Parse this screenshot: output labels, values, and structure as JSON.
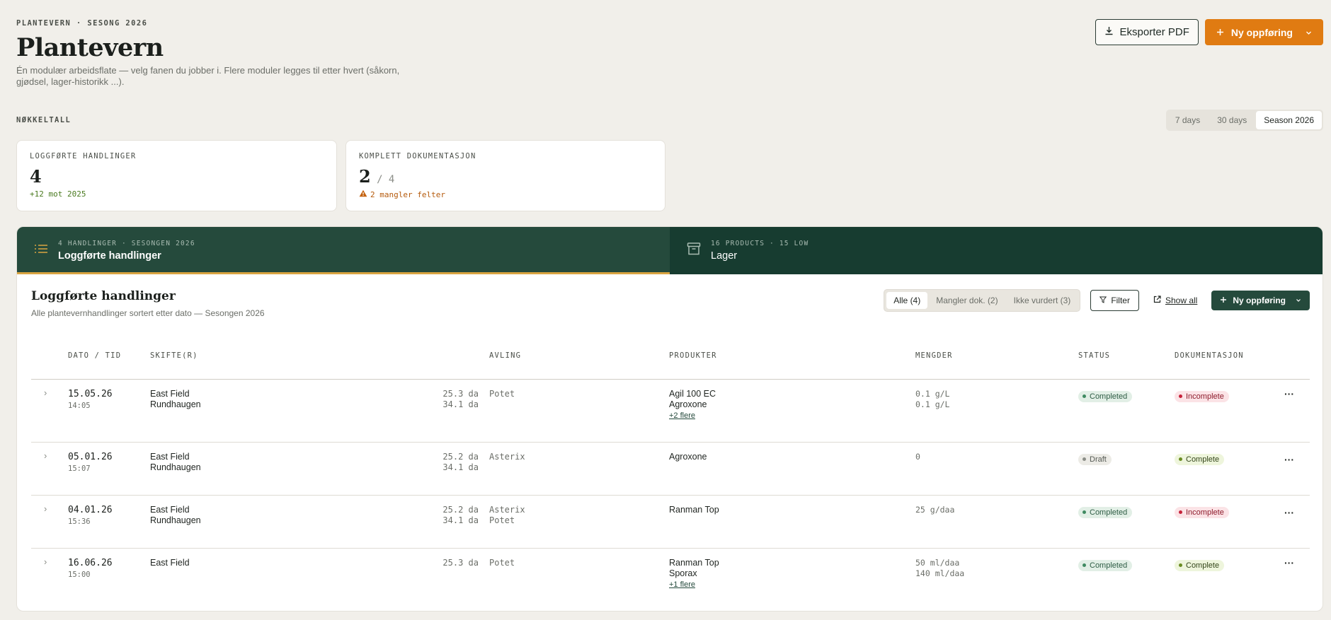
{
  "header": {
    "eyebrow": "PLANTEVERN · SESONG 2026",
    "title": "Plantevern",
    "subtitle": "Én modulær arbeidsflate — velg fanen du jobber i. Flere moduler legges til etter hvert (såkorn, gjødsel, lager-historikk ...).",
    "export_label": "Eksporter PDF",
    "new_entry_label": "Ny oppføring"
  },
  "kpi": {
    "section_label": "NØKKELTALL",
    "ranges": [
      "7 days",
      "30 days",
      "Season 2026"
    ],
    "active_range": "Season 2026",
    "cards": [
      {
        "title": "LOGGFØRTE HANDLINGER",
        "value": "4",
        "of": "",
        "note": "+12 mot 2025"
      },
      {
        "title": "KOMPLETT DOKUMENTASJON",
        "value": "2",
        "of": "/ 4",
        "note": "2 mangler felter"
      }
    ]
  },
  "tabs": [
    {
      "meta": "4 HANDLINGER · SESONGEN 2026",
      "name": "Loggførte handlinger",
      "icon": "list-icon",
      "active": true
    },
    {
      "meta": "16 PRODUCTS · 15 LOW",
      "name": "Lager",
      "icon": "archive-icon",
      "active": false
    }
  ],
  "section": {
    "title": "Loggførte handlinger",
    "subtitle": "Alle plantevernhandlinger sortert etter dato — Sesongen 2026",
    "segments": [
      "Alle (4)",
      "Mangler dok. (2)",
      "Ikke vurdert (3)"
    ],
    "filter_label": "Filter",
    "show_all_label": "Show all",
    "new_entry_label": "Ny oppføring"
  },
  "table": {
    "columns": {
      "date": "DATO / TID",
      "fields": "SKIFTE(R)",
      "crop": "AVLING",
      "products": "PRODUKTER",
      "amounts": "MENGDER",
      "status": "STATUS",
      "docs": "DOKUMENTASJON"
    },
    "rows": [
      {
        "date": "15.05.26",
        "time": "14:05",
        "fields": [
          "East Field",
          "Rundhaugen"
        ],
        "areas": [
          "25.3 da",
          "34.1 da"
        ],
        "crops": [
          "Potet"
        ],
        "products": [
          "Agil 100 EC",
          "Agroxone"
        ],
        "more": "+2 flere",
        "amounts": [
          "0.1 g/L",
          "0.1 g/L"
        ],
        "status": "Completed",
        "docs": "Incomplete"
      },
      {
        "date": "05.01.26",
        "time": "15:07",
        "fields": [
          "East Field",
          "Rundhaugen"
        ],
        "areas": [
          "25.2 da",
          "34.1 da"
        ],
        "crops": [
          "Asterix"
        ],
        "products": [
          "Agroxone"
        ],
        "more": "",
        "amounts": [
          "0"
        ],
        "status": "Draft",
        "docs": "Complete"
      },
      {
        "date": "04.01.26",
        "time": "15:36",
        "fields": [
          "East Field",
          "Rundhaugen"
        ],
        "areas": [
          "25.2 da",
          "34.1 da"
        ],
        "crops": [
          "Asterix",
          "Potet"
        ],
        "products": [
          "Ranman Top"
        ],
        "more": "",
        "amounts": [
          "25 g/daa"
        ],
        "status": "Completed",
        "docs": "Incomplete"
      },
      {
        "date": "16.06.26",
        "time": "15:00",
        "fields": [
          "East Field"
        ],
        "areas": [
          "25.3 da"
        ],
        "crops": [
          "Potet"
        ],
        "products": [
          "Ranman Top",
          "Sporax"
        ],
        "more": "+1 flere",
        "amounts": [
          "50 ml/daa",
          "140 ml/daa"
        ],
        "status": "Completed",
        "docs": "Complete"
      }
    ]
  },
  "colors": {
    "accent_orange": "#e07b12",
    "forest_green": "#254a3c",
    "tab_underline": "#d9a441",
    "background": "#f1efea"
  }
}
